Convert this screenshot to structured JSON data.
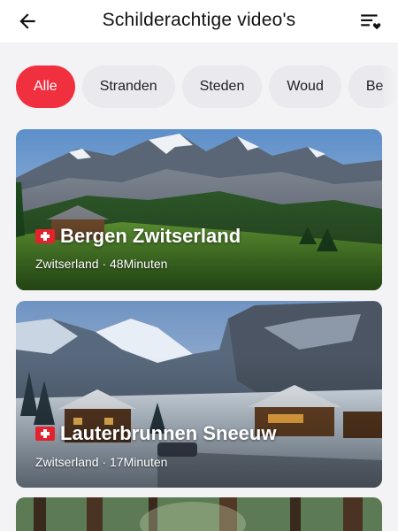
{
  "header": {
    "title": "Schilderachtige video's",
    "back_icon": "arrow-left-icon",
    "favorites_icon": "playlist-heart-icon"
  },
  "filters": [
    {
      "label": "Alle",
      "active": true
    },
    {
      "label": "Stranden",
      "active": false
    },
    {
      "label": "Steden",
      "active": false
    },
    {
      "label": "Woud",
      "active": false
    },
    {
      "label": "Be",
      "active": false
    }
  ],
  "videos": [
    {
      "title": "Bergen Zwitserland",
      "country": "Zwitserland",
      "duration": "48Minuten",
      "meta": "Zwitserland · 48Minuten",
      "flag_icon": "swiss-flag-icon"
    },
    {
      "title": "Lauterbrunnen Sneeuw",
      "country": "Zwitserland",
      "duration": "17Minuten",
      "meta": "Zwitserland · 17Minuten",
      "flag_icon": "swiss-flag-icon"
    }
  ],
  "colors": {
    "accent": "#f1303f",
    "chip_bg": "#e9e9ee",
    "background": "#f3f3f5"
  }
}
